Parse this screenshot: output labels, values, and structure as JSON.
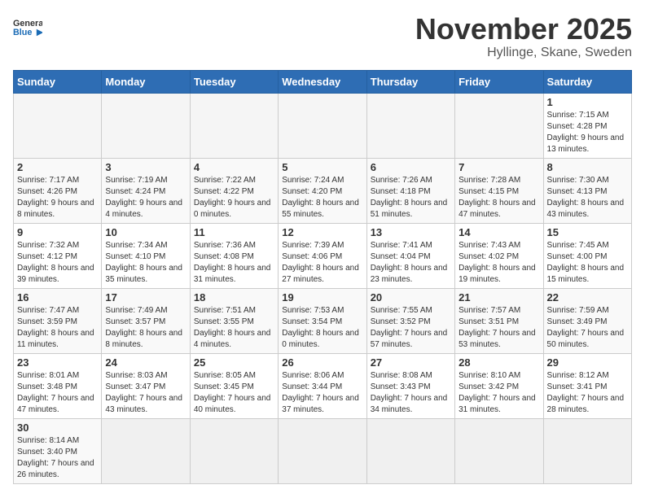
{
  "header": {
    "logo_general": "General",
    "logo_blue": "Blue",
    "month_title": "November 2025",
    "location": "Hyllinge, Skane, Sweden"
  },
  "days_of_week": [
    "Sunday",
    "Monday",
    "Tuesday",
    "Wednesday",
    "Thursday",
    "Friday",
    "Saturday"
  ],
  "weeks": [
    [
      {
        "day": null,
        "info": null
      },
      {
        "day": null,
        "info": null
      },
      {
        "day": null,
        "info": null
      },
      {
        "day": null,
        "info": null
      },
      {
        "day": null,
        "info": null
      },
      {
        "day": null,
        "info": null
      },
      {
        "day": "1",
        "info": "Sunrise: 7:15 AM\nSunset: 4:28 PM\nDaylight: 9 hours and 13 minutes."
      }
    ],
    [
      {
        "day": "2",
        "info": "Sunrise: 7:17 AM\nSunset: 4:26 PM\nDaylight: 9 hours and 8 minutes."
      },
      {
        "day": "3",
        "info": "Sunrise: 7:19 AM\nSunset: 4:24 PM\nDaylight: 9 hours and 4 minutes."
      },
      {
        "day": "4",
        "info": "Sunrise: 7:22 AM\nSunset: 4:22 PM\nDaylight: 9 hours and 0 minutes."
      },
      {
        "day": "5",
        "info": "Sunrise: 7:24 AM\nSunset: 4:20 PM\nDaylight: 8 hours and 55 minutes."
      },
      {
        "day": "6",
        "info": "Sunrise: 7:26 AM\nSunset: 4:18 PM\nDaylight: 8 hours and 51 minutes."
      },
      {
        "day": "7",
        "info": "Sunrise: 7:28 AM\nSunset: 4:15 PM\nDaylight: 8 hours and 47 minutes."
      },
      {
        "day": "8",
        "info": "Sunrise: 7:30 AM\nSunset: 4:13 PM\nDaylight: 8 hours and 43 minutes."
      }
    ],
    [
      {
        "day": "9",
        "info": "Sunrise: 7:32 AM\nSunset: 4:12 PM\nDaylight: 8 hours and 39 minutes."
      },
      {
        "day": "10",
        "info": "Sunrise: 7:34 AM\nSunset: 4:10 PM\nDaylight: 8 hours and 35 minutes."
      },
      {
        "day": "11",
        "info": "Sunrise: 7:36 AM\nSunset: 4:08 PM\nDaylight: 8 hours and 31 minutes."
      },
      {
        "day": "12",
        "info": "Sunrise: 7:39 AM\nSunset: 4:06 PM\nDaylight: 8 hours and 27 minutes."
      },
      {
        "day": "13",
        "info": "Sunrise: 7:41 AM\nSunset: 4:04 PM\nDaylight: 8 hours and 23 minutes."
      },
      {
        "day": "14",
        "info": "Sunrise: 7:43 AM\nSunset: 4:02 PM\nDaylight: 8 hours and 19 minutes."
      },
      {
        "day": "15",
        "info": "Sunrise: 7:45 AM\nSunset: 4:00 PM\nDaylight: 8 hours and 15 minutes."
      }
    ],
    [
      {
        "day": "16",
        "info": "Sunrise: 7:47 AM\nSunset: 3:59 PM\nDaylight: 8 hours and 11 minutes."
      },
      {
        "day": "17",
        "info": "Sunrise: 7:49 AM\nSunset: 3:57 PM\nDaylight: 8 hours and 8 minutes."
      },
      {
        "day": "18",
        "info": "Sunrise: 7:51 AM\nSunset: 3:55 PM\nDaylight: 8 hours and 4 minutes."
      },
      {
        "day": "19",
        "info": "Sunrise: 7:53 AM\nSunset: 3:54 PM\nDaylight: 8 hours and 0 minutes."
      },
      {
        "day": "20",
        "info": "Sunrise: 7:55 AM\nSunset: 3:52 PM\nDaylight: 7 hours and 57 minutes."
      },
      {
        "day": "21",
        "info": "Sunrise: 7:57 AM\nSunset: 3:51 PM\nDaylight: 7 hours and 53 minutes."
      },
      {
        "day": "22",
        "info": "Sunrise: 7:59 AM\nSunset: 3:49 PM\nDaylight: 7 hours and 50 minutes."
      }
    ],
    [
      {
        "day": "23",
        "info": "Sunrise: 8:01 AM\nSunset: 3:48 PM\nDaylight: 7 hours and 47 minutes."
      },
      {
        "day": "24",
        "info": "Sunrise: 8:03 AM\nSunset: 3:47 PM\nDaylight: 7 hours and 43 minutes."
      },
      {
        "day": "25",
        "info": "Sunrise: 8:05 AM\nSunset: 3:45 PM\nDaylight: 7 hours and 40 minutes."
      },
      {
        "day": "26",
        "info": "Sunrise: 8:06 AM\nSunset: 3:44 PM\nDaylight: 7 hours and 37 minutes."
      },
      {
        "day": "27",
        "info": "Sunrise: 8:08 AM\nSunset: 3:43 PM\nDaylight: 7 hours and 34 minutes."
      },
      {
        "day": "28",
        "info": "Sunrise: 8:10 AM\nSunset: 3:42 PM\nDaylight: 7 hours and 31 minutes."
      },
      {
        "day": "29",
        "info": "Sunrise: 8:12 AM\nSunset: 3:41 PM\nDaylight: 7 hours and 28 minutes."
      }
    ],
    [
      {
        "day": "30",
        "info": "Sunrise: 8:14 AM\nSunset: 3:40 PM\nDaylight: 7 hours and 26 minutes."
      },
      {
        "day": null,
        "info": null
      },
      {
        "day": null,
        "info": null
      },
      {
        "day": null,
        "info": null
      },
      {
        "day": null,
        "info": null
      },
      {
        "day": null,
        "info": null
      },
      {
        "day": null,
        "info": null
      }
    ]
  ]
}
